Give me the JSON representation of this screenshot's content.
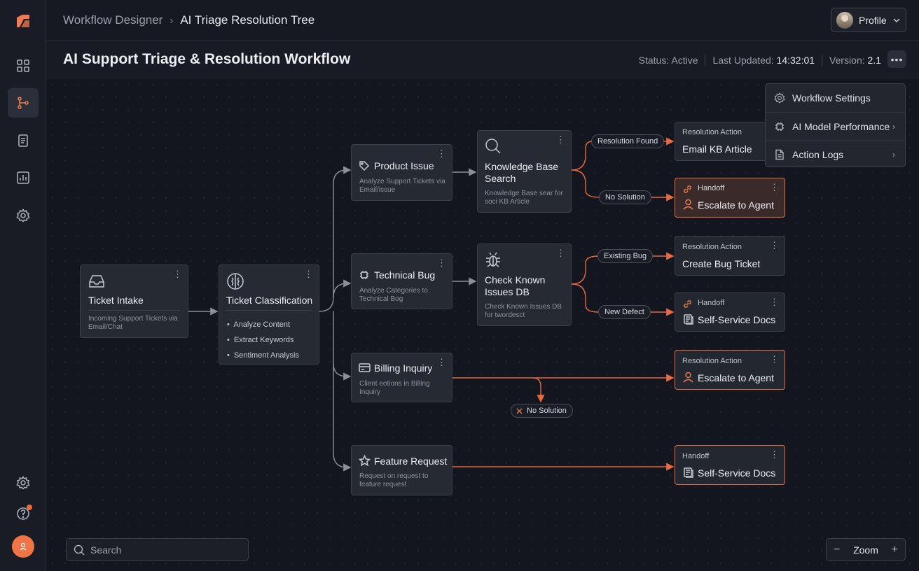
{
  "breadcrumb": {
    "root": "Workflow Designer",
    "current": "AI Triage Resolution Tree"
  },
  "profile": {
    "label": "Profile"
  },
  "page": {
    "title": "AI Support Triage & Resolution Workflow",
    "status_label": "Status:",
    "status_value": "Active",
    "updated_label": "Last Updated:",
    "updated_value": "14:32:01",
    "version_label": "Version:",
    "version_value": "2.1"
  },
  "menu": {
    "items": [
      {
        "label": "Workflow Settings",
        "icon": "gear-icon"
      },
      {
        "label": "AI Model Performance",
        "icon": "cpu-icon"
      },
      {
        "label": "Action Logs",
        "icon": "document-icon"
      }
    ]
  },
  "nodes": {
    "intake": {
      "title": "Ticket Intake",
      "desc": "Incoming Support Tickets via Email/Chat"
    },
    "classify": {
      "title": "Ticket Classification",
      "bullets": [
        "Analyze Content",
        "Extract Keywords",
        "Sentiment Analysis"
      ]
    },
    "product": {
      "title": "Product Issue",
      "desc": "Analyze Support Tickets via Email/issue"
    },
    "tech": {
      "title": "Technical Bug",
      "desc": "Analyze Categories to Technical Bog"
    },
    "billing": {
      "title": "Billing Inquiry",
      "desc": "Client eotions in Billing Inquiry"
    },
    "feature": {
      "title": "Feature Request",
      "desc": "Request on request to feature request"
    },
    "kb": {
      "title": "Knowledge Base Search",
      "desc": "Knowledge Base sear for soci KB Article"
    },
    "known": {
      "title": "Check Known Issues DB",
      "desc": "Check Known Issues DB for twordesct"
    },
    "r1": {
      "tag": "Resolution Action",
      "title": "Email KB Article"
    },
    "r2": {
      "tag": "Handoff",
      "title": "Escalate to Agent"
    },
    "r3": {
      "tag": "Resolution Action",
      "title": "Create Bug Ticket"
    },
    "r4": {
      "tag": "Handoff",
      "title": "Self-Service Docs"
    },
    "r5": {
      "tag": "Resolution Action",
      "title": "Escalate to Agent"
    },
    "r6": {
      "tag": "Handoff",
      "title": "Self-Service Docs"
    }
  },
  "edges": {
    "found": "Resolution Found",
    "no_solution": "No Solution",
    "existing": "Existing Bug",
    "new_defect": "New Defect",
    "billing_no_solution": "No Solution"
  },
  "search": {
    "placeholder": "Search"
  },
  "zoom": {
    "label": "Zoom",
    "minus": "−",
    "plus": "+"
  },
  "colors": {
    "accent": "#f07a52",
    "wire": "#8a8f99",
    "orange_wire": "#e86a3f"
  }
}
